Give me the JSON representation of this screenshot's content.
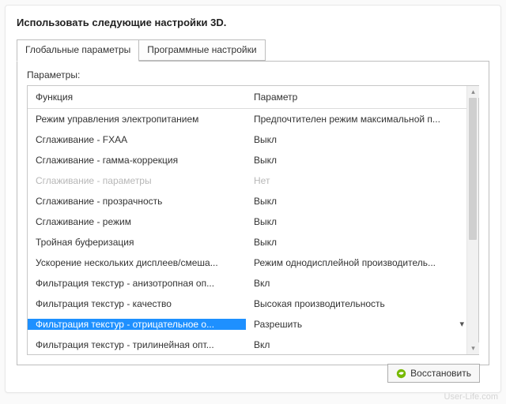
{
  "title": "Использовать следующие настройки 3D.",
  "tabs": {
    "global": "Глобальные параметры",
    "program": "Программные настройки"
  },
  "params_label": "Параметры:",
  "columns": {
    "func": "Функция",
    "param": "Параметр"
  },
  "rows": [
    {
      "func": "Режим управления электропитанием",
      "param": "Предпочтителен режим максимальной п...",
      "state": ""
    },
    {
      "func": "Сглаживание - FXAA",
      "param": "Выкл",
      "state": ""
    },
    {
      "func": "Сглаживание - гамма-коррекция",
      "param": "Выкл",
      "state": ""
    },
    {
      "func": "Сглаживание - параметры",
      "param": "Нет",
      "state": "disabled"
    },
    {
      "func": "Сглаживание - прозрачность",
      "param": "Выкл",
      "state": ""
    },
    {
      "func": "Сглаживание - режим",
      "param": "Выкл",
      "state": ""
    },
    {
      "func": "Тройная буферизация",
      "param": "Выкл",
      "state": ""
    },
    {
      "func": "Ускорение нескольких дисплеев/смеша...",
      "param": "Режим однодисплейной производитель...",
      "state": ""
    },
    {
      "func": "Фильтрация текстур - анизотропная оп...",
      "param": "Вкл",
      "state": ""
    },
    {
      "func": "Фильтрация текстур - качество",
      "param": "Высокая производительность",
      "state": ""
    },
    {
      "func": "Фильтрация текстур - отрицательное о...",
      "param": "Разрешить",
      "state": "selected"
    },
    {
      "func": "Фильтрация текстур - трилинейная опт...",
      "param": "Вкл",
      "state": ""
    }
  ],
  "restore_label": "Восстановить",
  "watermark": "User-Life.com"
}
